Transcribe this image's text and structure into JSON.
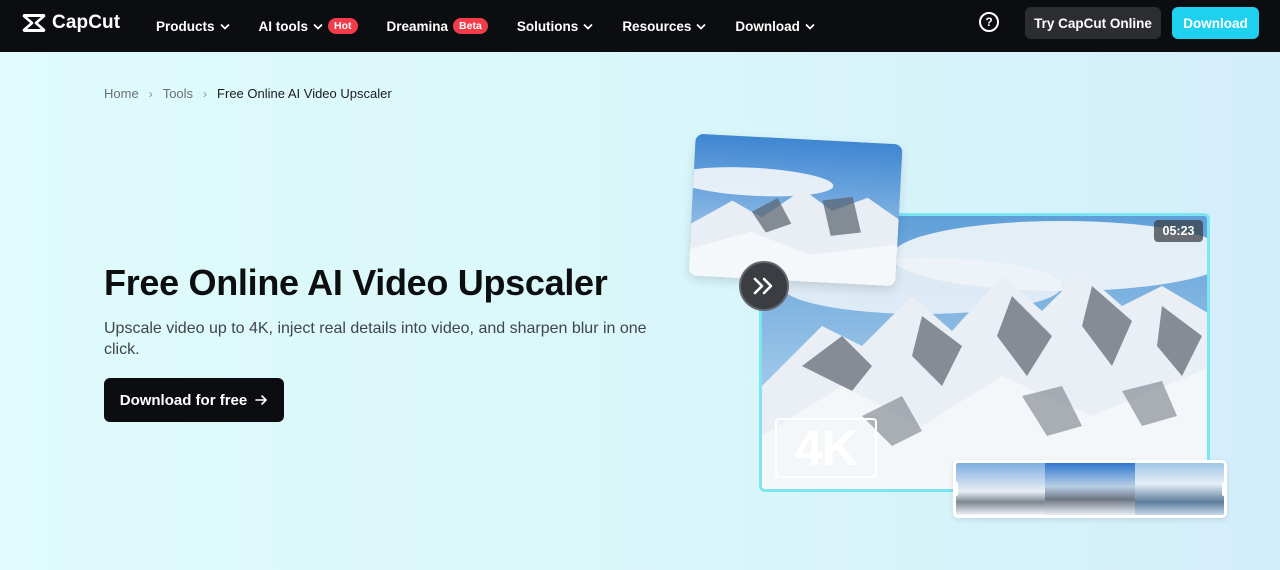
{
  "nav": {
    "logo": "CapCut",
    "items": [
      {
        "label": "Products",
        "badge": ""
      },
      {
        "label": "AI tools",
        "badge": "Hot"
      },
      {
        "label": "Dreamina",
        "badge": "Beta"
      },
      {
        "label": "Solutions",
        "badge": ""
      },
      {
        "label": "Resources",
        "badge": ""
      },
      {
        "label": "Download",
        "badge": ""
      }
    ],
    "help_icon": "question-circle-icon",
    "try_label": "Try CapCut Online",
    "download_label": "Download"
  },
  "breadcrumb": {
    "items": [
      "Home",
      "Tools"
    ],
    "current": "Free Online AI Video Upscaler"
  },
  "hero": {
    "title": "Free Online AI Video Upscaler",
    "subtitle": "Upscale video up to 4K, inject real details into video, and sharpen blur in one click.",
    "cta_label": "Download for free",
    "timestamp": "05:23",
    "resolution_badge": "4K"
  },
  "colors": {
    "nav_bg": "#0c0d10",
    "accent": "#1fd1ef",
    "badge_red": "#f23c4a",
    "hero_bg": "#dff7f9"
  }
}
